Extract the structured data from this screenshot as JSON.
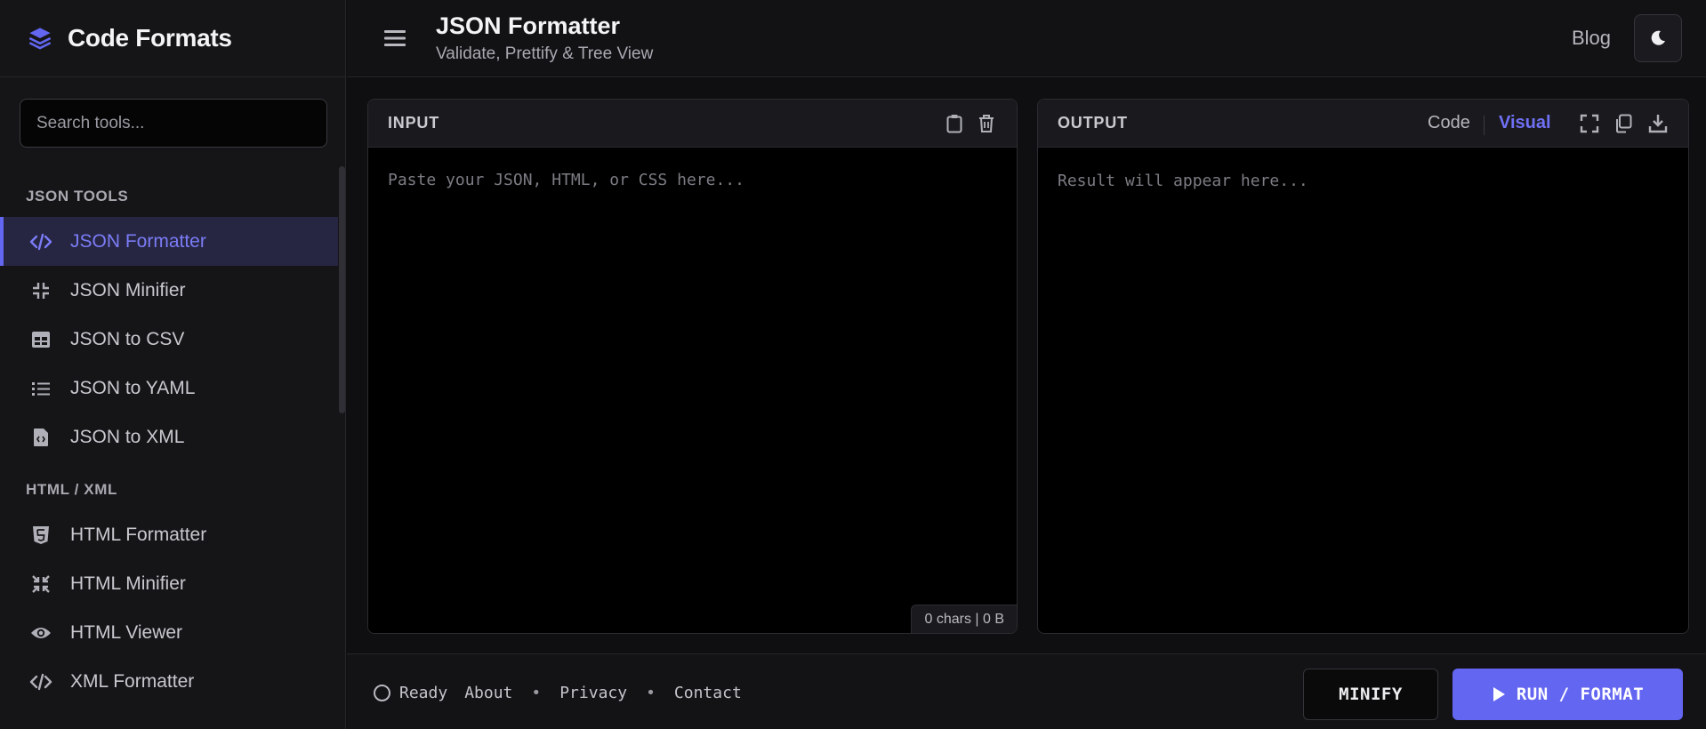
{
  "brand": {
    "title": "Code Formats",
    "icon": "layers-icon"
  },
  "search": {
    "placeholder": "Search tools..."
  },
  "sidebar": {
    "sections": [
      {
        "label": "JSON TOOLS",
        "items": [
          {
            "label": "JSON Formatter",
            "icon": "code-icon",
            "active": true
          },
          {
            "label": "JSON Minifier",
            "icon": "compress-icon"
          },
          {
            "label": "JSON to CSV",
            "icon": "table-icon"
          },
          {
            "label": "JSON to YAML",
            "icon": "list-icon"
          },
          {
            "label": "JSON to XML",
            "icon": "file-code-icon"
          }
        ]
      },
      {
        "label": "HTML / XML",
        "items": [
          {
            "label": "HTML Formatter",
            "icon": "html5-icon"
          },
          {
            "label": "HTML Minifier",
            "icon": "compress-arrows-icon"
          },
          {
            "label": "HTML Viewer",
            "icon": "eye-icon"
          },
          {
            "label": "XML Formatter",
            "icon": "code-icon"
          }
        ]
      }
    ]
  },
  "header": {
    "title": "JSON Formatter",
    "subtitle": "Validate, Prettify & Tree View",
    "blog": "Blog"
  },
  "input_panel": {
    "label": "INPUT",
    "placeholder": "Paste your JSON, HTML, or CSS here...",
    "counter": "0 chars | 0 B"
  },
  "output_panel": {
    "label": "OUTPUT",
    "view_code": "Code",
    "view_visual": "Visual",
    "placeholder": "Result will appear here..."
  },
  "footer": {
    "status": "Ready",
    "about": "About",
    "privacy": "Privacy",
    "contact": "Contact",
    "separator": "•",
    "minify": "MINIFY",
    "run": "RUN / FORMAT"
  },
  "colors": {
    "accent": "#6366f1",
    "active_bg": "#262642",
    "background": "#0f0f11"
  }
}
